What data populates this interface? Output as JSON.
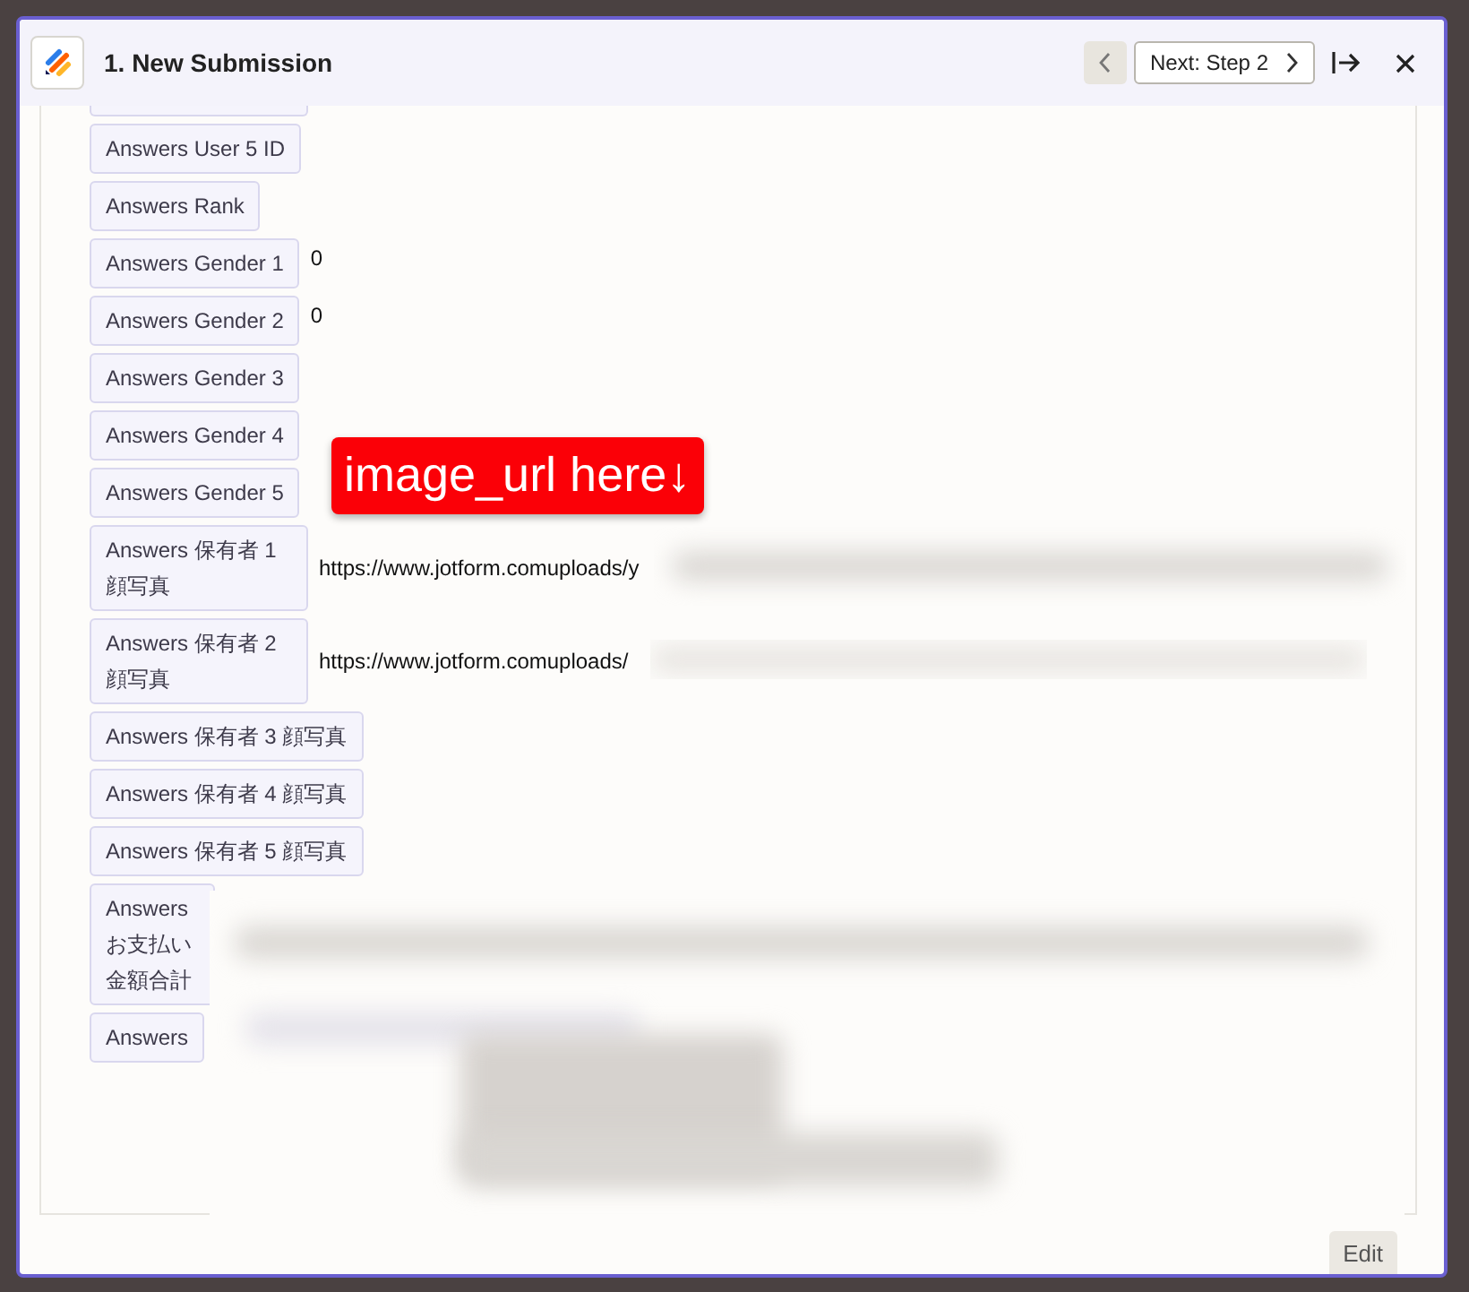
{
  "header": {
    "title": "1. New Submission",
    "prev_button": {
      "disabled": true
    },
    "next_button": {
      "label": "Next: Step 2"
    }
  },
  "fields": [
    {
      "label": "Answers User 5 ID"
    },
    {
      "label": "Answers Rank"
    },
    {
      "label": "Answers Gender 1",
      "value": "0"
    },
    {
      "label": "Answers Gender 2",
      "value": "0"
    },
    {
      "label": "Answers Gender 3"
    },
    {
      "label": "Answers Gender 4"
    },
    {
      "label": "Answers Gender 5"
    },
    {
      "label": "Answers 保有者 1 顔写真",
      "value": "https://www.jotform.comuploads/y"
    },
    {
      "label": "Answers 保有者 2 顔写真",
      "value": "https://www.jotform.comuploads/"
    },
    {
      "label": "Answers 保有者 3 顔写真"
    },
    {
      "label": "Answers 保有者 4 顔写真"
    },
    {
      "label": "Answers 保有者 5 顔写真"
    },
    {
      "label": "Answers お支払い金額合計",
      "redacted": true
    },
    {
      "label": "Answers",
      "redacted": true
    }
  ],
  "annotation": {
    "text": "image_url here↓"
  },
  "footer": {
    "button": "Edit"
  }
}
